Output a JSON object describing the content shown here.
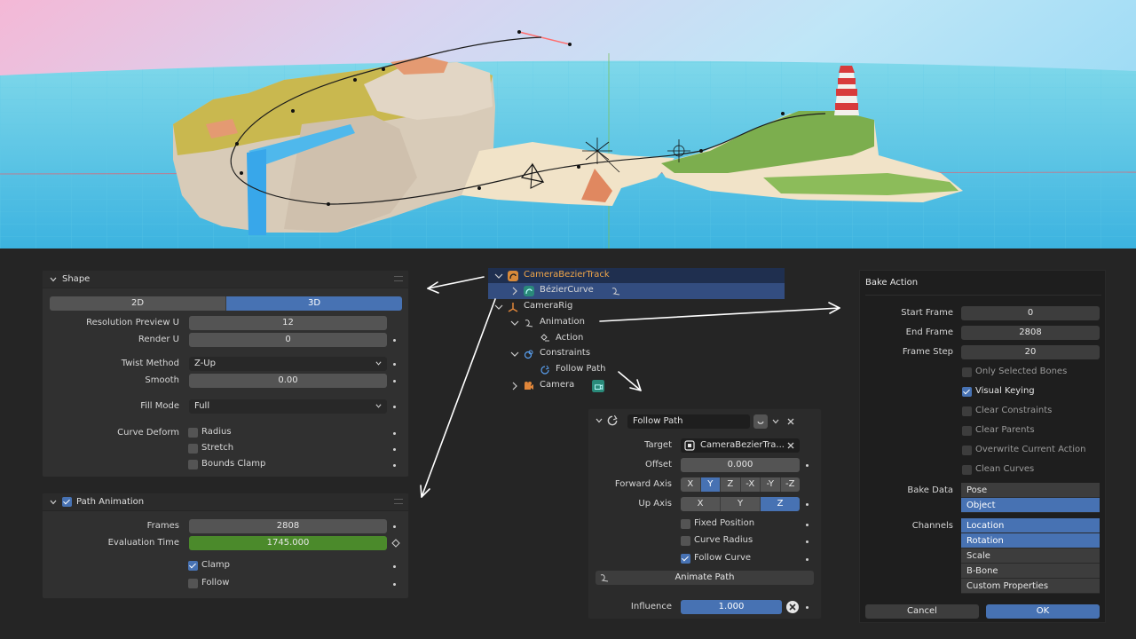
{
  "shape_panel": {
    "title": "Shape",
    "dim_2d": "2D",
    "dim_3d": "3D",
    "resolution_preview_u_label": "Resolution Preview U",
    "resolution_preview_u": "12",
    "render_u_label": "Render U",
    "render_u": "0",
    "twist_method_label": "Twist Method",
    "twist_method": "Z-Up",
    "smooth_label": "Smooth",
    "smooth": "0.00",
    "fill_mode_label": "Fill Mode",
    "fill_mode": "Full",
    "curve_deform_label": "Curve Deform",
    "radius": "Radius",
    "stretch": "Stretch",
    "bounds_clamp": "Bounds Clamp"
  },
  "path_panel": {
    "title": "Path Animation",
    "frames_label": "Frames",
    "frames": "2808",
    "eval_time_label": "Evaluation Time",
    "eval_time": "1745.000",
    "clamp": "Clamp",
    "follow": "Follow"
  },
  "outliner": {
    "camera_bezier_track": "CameraBezierTrack",
    "bezier_curve": "BézierCurve",
    "camera_rig": "CameraRig",
    "animation": "Animation",
    "action": "Action",
    "constraints": "Constraints",
    "follow_path": "Follow Path",
    "camera": "Camera"
  },
  "constraint": {
    "name": "Follow Path",
    "target_label": "Target",
    "target": "CameraBezierTra...",
    "offset_label": "Offset",
    "offset": "0.000",
    "forward_axis_label": "Forward Axis",
    "forward_axes": [
      "X",
      "Y",
      "Z",
      "-X",
      "-Y",
      "-Z"
    ],
    "forward_selected": 1,
    "up_axis_label": "Up Axis",
    "up_axes": [
      "X",
      "Y",
      "Z"
    ],
    "up_selected": 2,
    "fixed_position": "Fixed Position",
    "curve_radius": "Curve Radius",
    "follow_curve": "Follow Curve",
    "animate_path": "Animate Path",
    "influence_label": "Influence",
    "influence": "1.000"
  },
  "bake": {
    "title": "Bake Action",
    "start_frame_label": "Start Frame",
    "start_frame": "0",
    "end_frame_label": "End Frame",
    "end_frame": "2808",
    "frame_step_label": "Frame Step",
    "frame_step": "20",
    "only_selected_bones": "Only Selected Bones",
    "visual_keying": "Visual Keying",
    "clear_constraints": "Clear Constraints",
    "clear_parents": "Clear Parents",
    "overwrite_current_action": "Overwrite Current Action",
    "clean_curves": "Clean Curves",
    "bake_data_label": "Bake Data",
    "bake_data": [
      "Pose",
      "Object"
    ],
    "channels_label": "Channels",
    "channels": [
      "Location",
      "Rotation",
      "Scale",
      "B-Bone",
      "Custom Properties"
    ],
    "cancel": "Cancel",
    "ok": "OK"
  },
  "colors": {
    "accent": "#4772b3",
    "green_field": "#4b8a2b",
    "outliner_select": "#334d80"
  }
}
